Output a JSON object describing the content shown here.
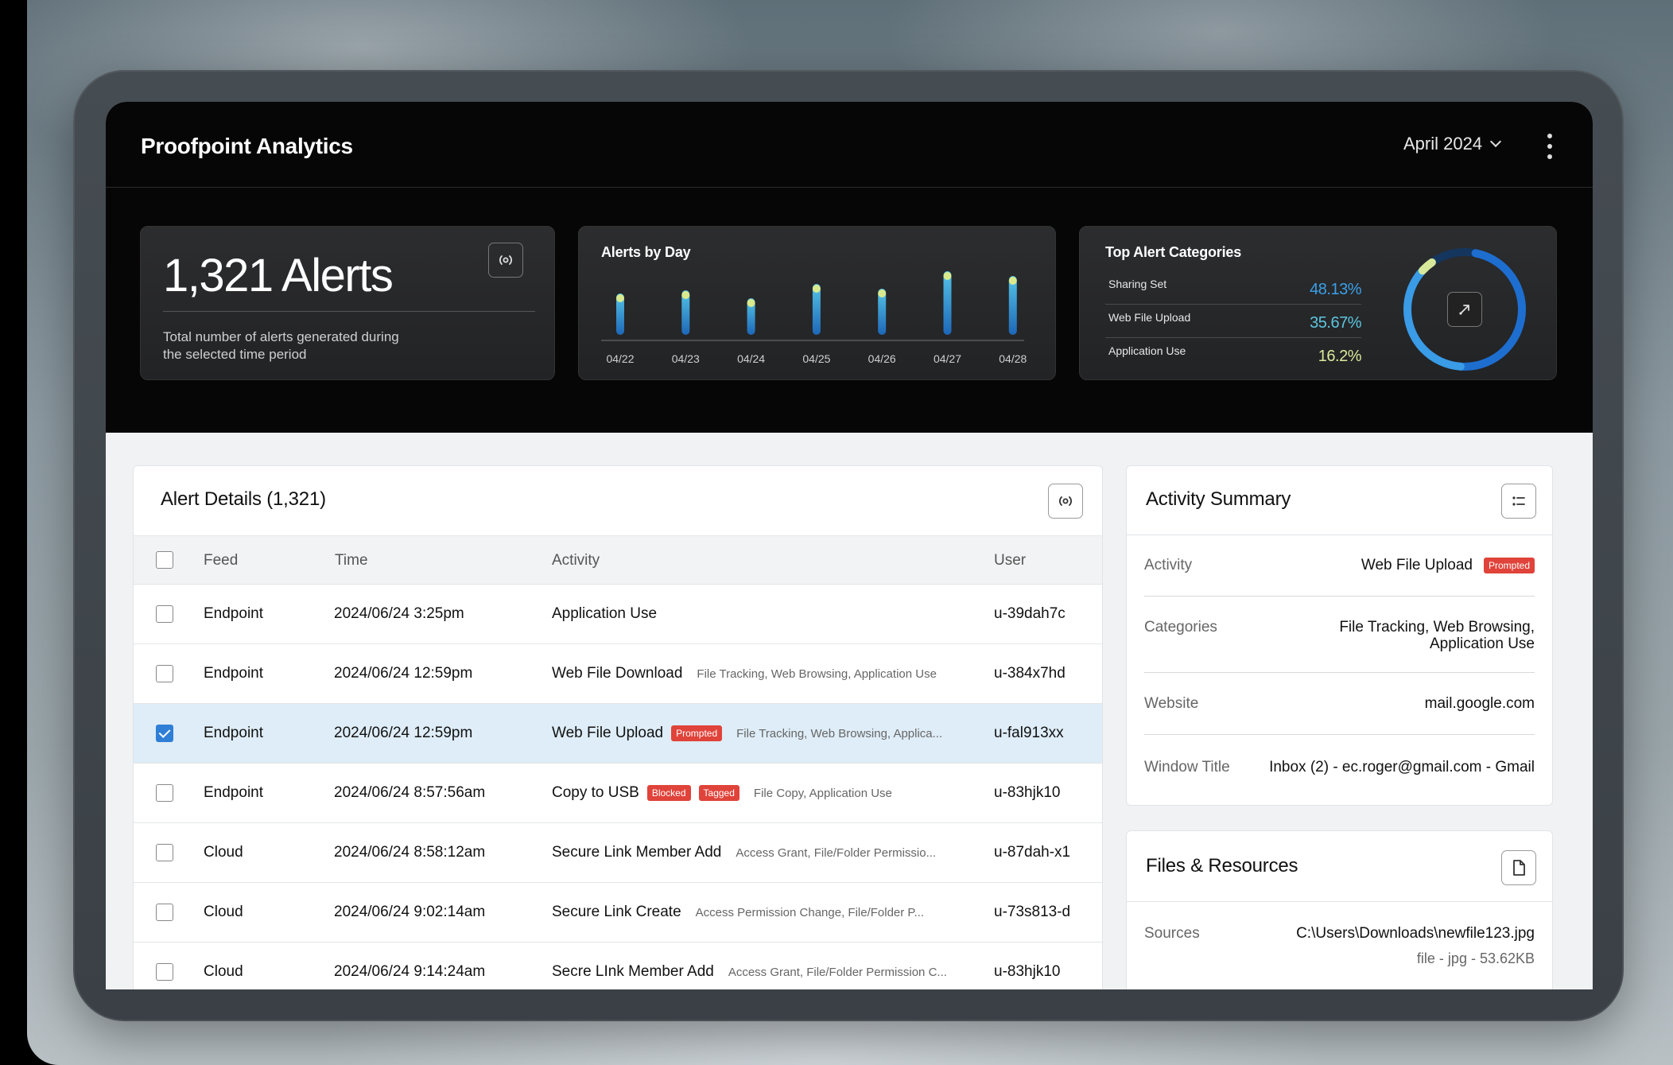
{
  "header": {
    "app_title": "Proofpoint Analytics",
    "month": "April 2024"
  },
  "summary_card": {
    "count_label": "1,321 Alerts",
    "description": "Total number of alerts generated during the selected time period"
  },
  "alerts_by_day": {
    "title": "Alerts by Day"
  },
  "chart_data": [
    {
      "type": "bar",
      "title": "Alerts by Day",
      "categories": [
        "04/22",
        "04/23",
        "04/24",
        "04/25",
        "04/26",
        "04/27",
        "04/28"
      ],
      "values": [
        52,
        56,
        46,
        64,
        58,
        80,
        74
      ],
      "ylim": [
        0,
        100
      ],
      "grid": false
    },
    {
      "type": "pie",
      "title": "Top Alert Categories",
      "categories": [
        "Sharing Set",
        "Web File Upload",
        "Application Use"
      ],
      "values": [
        48.13,
        35.67,
        16.2
      ]
    }
  ],
  "top_categories": {
    "title": "Top Alert Categories",
    "items": [
      {
        "name": "Sharing Set",
        "pct": "48.13%",
        "color": "#3aa0e8"
      },
      {
        "name": "Web File Upload",
        "pct": "35.67%",
        "color": "#5cc6e0"
      },
      {
        "name": "Application Use",
        "pct": "16.2%",
        "color": "#d8e89a"
      }
    ]
  },
  "alerts_table": {
    "title": "Alert Details (1,321)",
    "columns": [
      "Feed",
      "Time",
      "Activity",
      "User"
    ],
    "rows": [
      {
        "feed": "Endpoint",
        "time": "2024/06/24 3:25pm",
        "activity": "Application Use",
        "badges": [],
        "tags": "",
        "user": "u-39dah7c",
        "checked": false
      },
      {
        "feed": "Endpoint",
        "time": "2024/06/24 12:59pm",
        "activity": "Web File Download",
        "badges": [],
        "tags": "File Tracking, Web Browsing, Application Use",
        "user": "u-384x7hd",
        "checked": false
      },
      {
        "feed": "Endpoint",
        "time": "2024/06/24 12:59pm",
        "activity": "Web File Upload",
        "badges": [
          "Prompted"
        ],
        "tags": "File Tracking, Web Browsing, Applica...",
        "user": "u-fal913xx",
        "checked": true
      },
      {
        "feed": "Endpoint",
        "time": "2024/06/24 8:57:56am",
        "activity": "Copy to USB",
        "badges": [
          "Blocked",
          "Tagged"
        ],
        "tags": "File Copy, Application Use",
        "user": "u-83hjk10",
        "checked": false
      },
      {
        "feed": "Cloud",
        "time": "2024/06/24 8:58:12am",
        "activity": "Secure Link Member Add",
        "badges": [],
        "tags": "Access Grant, File/Folder Permissio...",
        "user": "u-87dah-x1",
        "checked": false
      },
      {
        "feed": "Cloud",
        "time": "2024/06/24 9:02:14am",
        "activity": "Secure Link Create",
        "badges": [],
        "tags": "Access Permission Change, File/Folder P...",
        "user": "u-73s813-d",
        "checked": false
      },
      {
        "feed": "Cloud",
        "time": "2024/06/24 9:14:24am",
        "activity": "Secre LInk Member Add",
        "badges": [],
        "tags": "Access Grant, File/Folder Permission C...",
        "user": "u-83hjk10",
        "checked": false
      }
    ]
  },
  "activity_summary": {
    "title": "Activity Summary",
    "activity_label": "Activity",
    "activity_value": "Web File Upload",
    "activity_badge": "Prompted",
    "categories_label": "Categories",
    "categories_line1": "File Tracking, Web Browsing,",
    "categories_line2": "Application Use",
    "website_label": "Website",
    "website_value": "mail.google.com",
    "window_title_label": "Window Title",
    "window_title_value": "Inbox (2) - ec.roger@gmail.com - Gmail"
  },
  "files_resources": {
    "title": "Files & Resources",
    "sources_label": "Sources",
    "sources_path": "C:\\Users\\Downloads\\newfile123.jpg",
    "sources_meta": "file - jpg - 53.62KB"
  },
  "colors": {
    "bar_dark": "#1d67b8",
    "bar_mid": "#3ba0de",
    "bar_light": "#d9ea8e",
    "badge_red": "#e0433a",
    "donut_blue": "#1e6ed0",
    "selected_row": "#deedf7"
  },
  "icons": {
    "summary_card_button": "radar-icon",
    "donut_button": "expand-arrow-icon",
    "alerts_button": "radar-icon",
    "activity_button": "list-icon",
    "files_button": "file-icon"
  }
}
